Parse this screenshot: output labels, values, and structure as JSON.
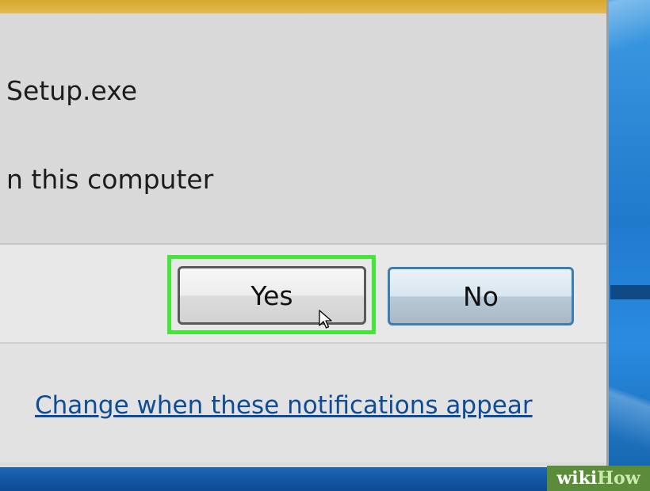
{
  "dialog": {
    "line1": "Setup.exe",
    "line2": "n this computer",
    "yes_label": "Yes",
    "no_label": "No",
    "link_text": "Change when these notifications appear"
  },
  "watermark": {
    "part1": "wiki",
    "part2": "How"
  },
  "colors": {
    "highlight": "#46e53a",
    "link": "#0e4c96",
    "titlebar": "#d8a72c"
  },
  "icons": {
    "cursor": "mouse-pointer-icon"
  }
}
